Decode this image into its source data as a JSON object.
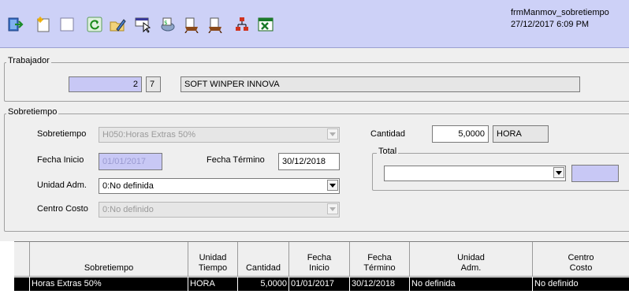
{
  "toolbar": {
    "icons": [
      "exit-icon",
      "new-icon",
      "blank-icon",
      "refresh-icon",
      "edit-icon",
      "select-icon",
      "record-icon",
      "report-icon",
      "report2-icon",
      "tree-icon",
      "excel-icon"
    ],
    "form_name": "frmManmov_sobretiempo",
    "datetime": "27/12/2017 6:09 PM"
  },
  "trabajador": {
    "legend": "Trabajador",
    "id_value": "2",
    "check_digit": "7",
    "name": "SOFT WINPER INNOVA"
  },
  "sobretiempo": {
    "legend": "Sobretiempo",
    "sobretiempo_label": "Sobretiempo",
    "sobretiempo_value": "H050:Horas Extras 50%",
    "fecha_inicio_label": "Fecha Inicio",
    "fecha_inicio_value": "01/01/2017",
    "fecha_termino_label": "Fecha Término",
    "fecha_termino_value": "30/12/2018",
    "unidad_label": "Unidad Adm.",
    "unidad_value": "0:No definida",
    "centro_label": "Centro Costo",
    "centro_value": "0:No definido",
    "cantidad_label": "Cantidad",
    "cantidad_value": "5,0000",
    "unidad_tiempo": "HORA",
    "total_legend": "Total",
    "total_value": ""
  },
  "grid": {
    "headers": [
      {
        "l1": "",
        "l2": "Sobretiempo"
      },
      {
        "l1": "Unidad",
        "l2": "Tiempo"
      },
      {
        "l1": "",
        "l2": "Cantidad"
      },
      {
        "l1": "Fecha",
        "l2": "Inicio"
      },
      {
        "l1": "Fecha",
        "l2": "Término"
      },
      {
        "l1": "Unidad",
        "l2": "Adm."
      },
      {
        "l1": "Centro",
        "l2": "Costo"
      }
    ],
    "rows": [
      [
        "Horas Extras 50%",
        "HORA",
        "5,0000",
        "01/01/2017",
        "30/12/2018",
        "No definida",
        "No definido"
      ]
    ]
  }
}
